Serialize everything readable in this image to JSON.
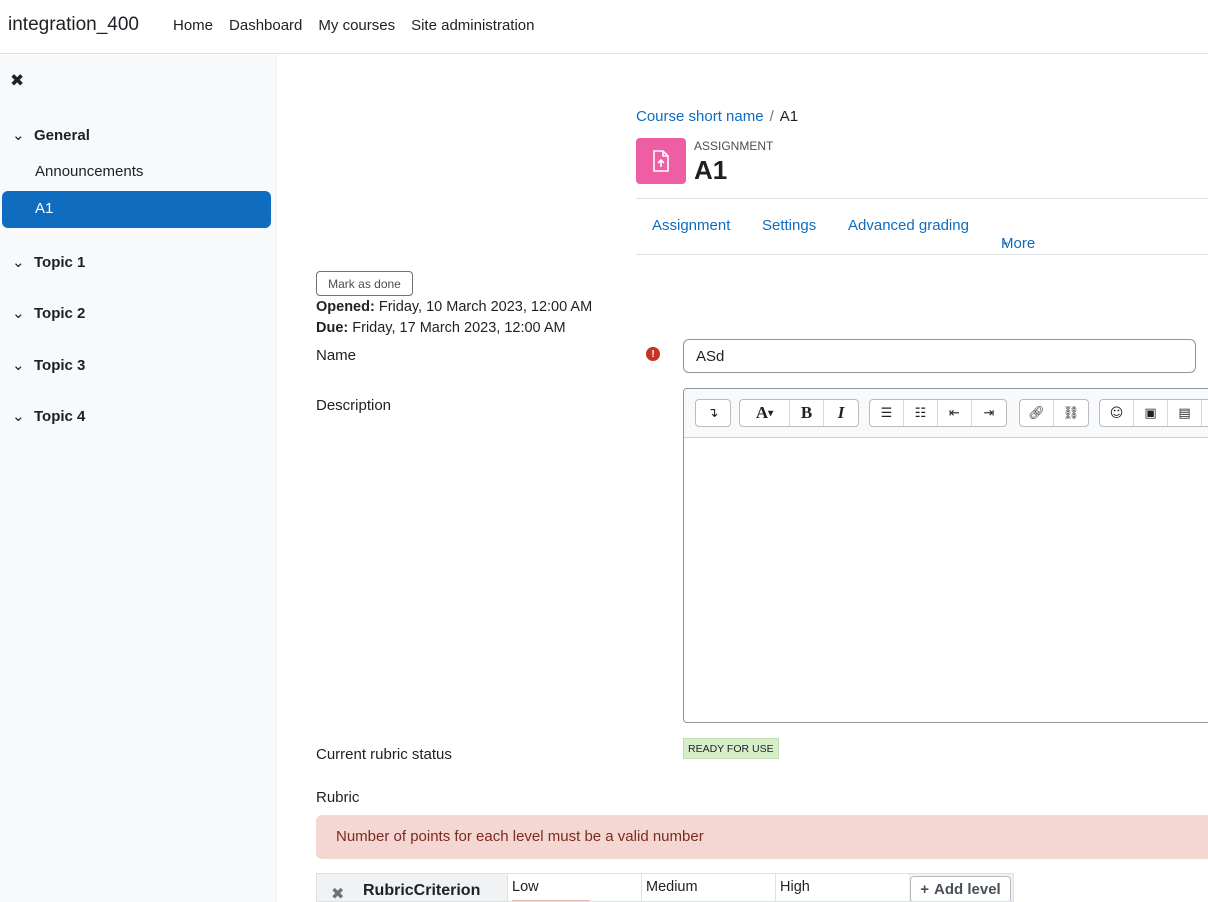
{
  "navbar": {
    "brand": "integration_400",
    "links": [
      "Home",
      "Dashboard",
      "My courses",
      "Site administration"
    ]
  },
  "drawer": {
    "close_icon": "close-icon",
    "sections": [
      {
        "label": "General"
      },
      {
        "label": "Topic 1"
      },
      {
        "label": "Topic 2"
      },
      {
        "label": "Topic 3"
      },
      {
        "label": "Topic 4"
      }
    ],
    "general_items": [
      "Announcements",
      "A1"
    ],
    "active_item": "A1"
  },
  "breadcrumb": {
    "course": "Course short name",
    "separator": "/",
    "current": "A1"
  },
  "activity": {
    "type": "ASSIGNMENT",
    "title": "A1",
    "icon_color": "#ee5ea4"
  },
  "secondary_nav": {
    "items": [
      "Assignment",
      "Settings",
      "Advanced grading",
      "More"
    ]
  },
  "completion": {
    "mark_done_label": "Mark as done"
  },
  "dates": {
    "opened_label": "Opened:",
    "opened_value": "Friday, 10 March 2023, 12:00 AM",
    "due_label": "Due:",
    "due_value": "Friday, 17 March 2023, 12:00 AM"
  },
  "form": {
    "name_label": "Name",
    "name_value": "ASd",
    "required_icon": "exclamation-icon",
    "description_label": "Description",
    "rubric_status_label": "Current rubric status",
    "rubric_status_value": "READY FOR USE",
    "rubric_label": "Rubric"
  },
  "editor": {
    "toolbar_icons": [
      "collapse-icon",
      "font-style-icon",
      "bold-icon",
      "italic-icon",
      "unordered-list-icon",
      "ordered-list-icon",
      "outdent-icon",
      "indent-icon",
      "link-icon",
      "unlink-icon",
      "emoji-icon",
      "image-icon",
      "media-icon"
    ]
  },
  "alert": {
    "message": "Number of points for each level must be a valid number"
  },
  "rubric": {
    "criterion": "RubricCriterion",
    "levels": [
      "Low",
      "Medium",
      "High"
    ],
    "add_level_label": "Add level"
  },
  "colors": {
    "accent": "#0f6cbf",
    "error": "#ca3120",
    "alert_bg": "#f4d6d2"
  }
}
